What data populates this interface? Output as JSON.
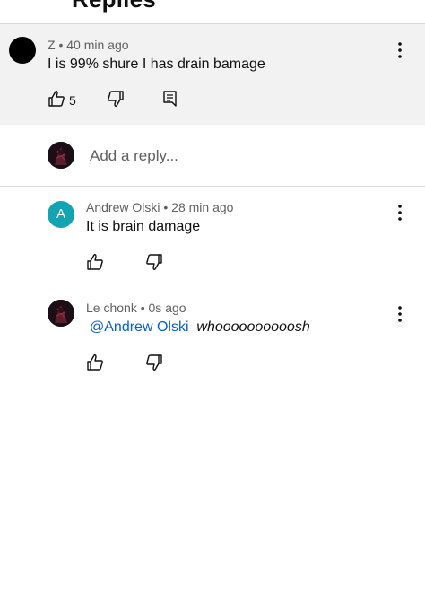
{
  "header": {
    "title": "Replies"
  },
  "parent_comment": {
    "author": "Z",
    "time": "40 min ago",
    "text": "I is 99% shure I has drain bamage",
    "likes": "5"
  },
  "reply_box": {
    "placeholder": "Add a reply..."
  },
  "replies": [
    {
      "author": "Andrew Olski",
      "time": "28 min ago",
      "text": "It is brain damage",
      "avatar_letter": "A",
      "avatar_color": "#12a4b0"
    },
    {
      "author": "Le chonk",
      "time": "0s ago",
      "mention": "@Andrew Olski",
      "text": "whoooooooooosh"
    }
  ],
  "separator": "•",
  "colors": {
    "meta": "#606060",
    "mention": "#065fd4",
    "parent_bg": "#f2f2f2"
  }
}
